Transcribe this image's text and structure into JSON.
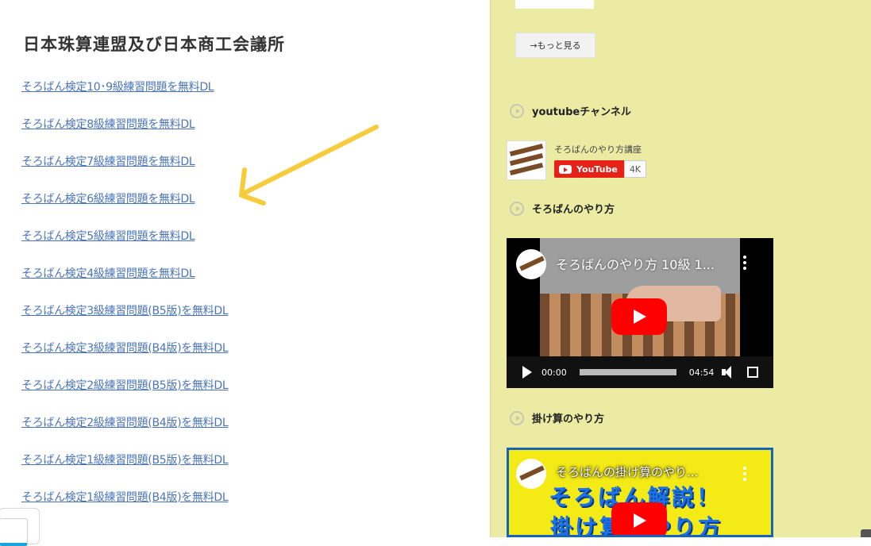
{
  "main": {
    "heading": "日本珠算連盟及び日本商工会議所",
    "links": [
      "そろばん検定10･9級練習問題を無料DL",
      "そろばん検定8級練習問題を無料DL",
      "そろばん検定7級練習問題を無料DL",
      "そろばん検定6級練習問題を無料DL",
      "そろばん検定5級練習問題を無料DL",
      "そろばん検定4級練習問題を無料DL",
      "そろばん検定3級練習問題(B5版)を無料DL",
      "そろばん検定3級練習問題(B4版)を無料DL",
      "そろばん検定2級練習問題(B5版)を無料DL",
      "そろばん検定2級練習問題(B4版)を無料DL",
      "そろばん検定1級練習問題(B5版)を無料DL",
      "そろばん検定1級練習問題(B4版)を無料DL"
    ],
    "arrow_color": "#f7cc3a"
  },
  "sidebar": {
    "more_button": "→もっと見る",
    "youtube_section_title": "youtubeチャンネル",
    "channel": {
      "name": "そろばんのやり方講座",
      "subscribe_label": "YouTube",
      "subscriber_count": "4K"
    },
    "video1_section_title": "そろばんのやり方",
    "video1": {
      "title": "そろばんのやり方 10級 1...",
      "current_time": "00:00",
      "duration": "04:54"
    },
    "video2_section_title": "掛け算のやり方",
    "video2": {
      "title": "そろばんの掛け算のやり...",
      "thumb_line1": "そろばん解説！",
      "thumb_line2": "掛け算のやり方"
    },
    "colors": {
      "background": "#ebeba4",
      "youtube_red": "#e62117",
      "link": "#4a74b7"
    }
  }
}
